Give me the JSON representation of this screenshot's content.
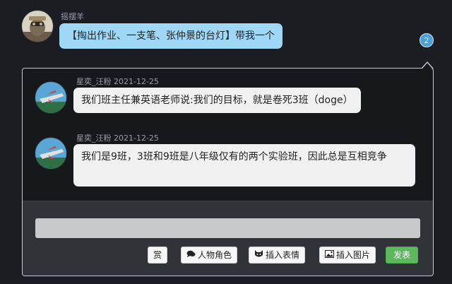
{
  "post": {
    "author": "摇摆羊",
    "message": "【掏出作业、一支笔、张仲景的台灯】带我一个",
    "reply_count": "2"
  },
  "replies": [
    {
      "author": "星奕_汪粉",
      "date": "2021-12-25",
      "text": "我们班主任兼英语老师说:我们的目标，就是卷死3班（doge）"
    },
    {
      "author": "星奕_汪粉",
      "date": "2021-12-25",
      "text": "我们是9班，3班和9班是八年级仅有的两个实验班，因此总是互相竞争"
    }
  ],
  "composer": {
    "input_value": "",
    "tip_label": "赏",
    "role_label": "人物角色",
    "emoji_label": "插入表情",
    "image_label": "插入图片",
    "submit_label": "发表"
  },
  "colors": {
    "background": "#1b1d22",
    "op_bubble": "#9fd8f7",
    "reply_bubble": "#f1f1f1",
    "submit": "#5cb85c",
    "badge": "#4aa0d8"
  },
  "icons": {
    "role": "comments-icon",
    "emoji": "cat-face-icon",
    "image": "image-icon"
  }
}
